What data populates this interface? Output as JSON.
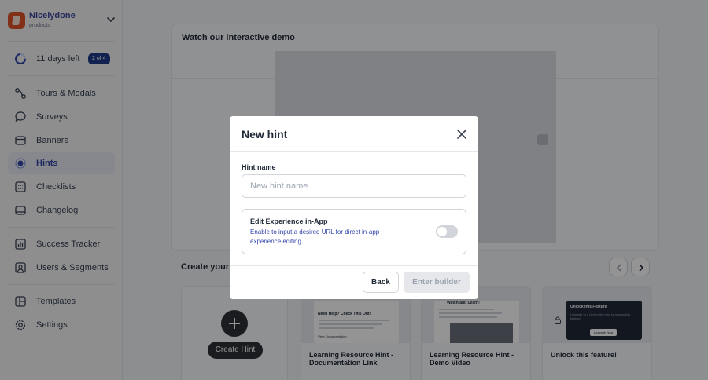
{
  "brand": {
    "name": "Nicelydone",
    "sub": "products"
  },
  "trial": {
    "text": "11 days left",
    "badge": "2 of 4"
  },
  "sidebar": {
    "items": [
      {
        "label": "Tours & Modals",
        "icon": "tours-icon"
      },
      {
        "label": "Surveys",
        "icon": "surveys-icon"
      },
      {
        "label": "Banners",
        "icon": "banners-icon"
      },
      {
        "label": "Hints",
        "icon": "hints-icon",
        "active": true
      },
      {
        "label": "Checklists",
        "icon": "checklists-icon"
      },
      {
        "label": "Changelog",
        "icon": "changelog-icon"
      },
      {
        "label": "Success Tracker",
        "icon": "success-tracker-icon"
      },
      {
        "label": "Users & Segments",
        "icon": "users-segments-icon"
      },
      {
        "label": "Templates",
        "icon": "templates-icon"
      },
      {
        "label": "Settings",
        "icon": "settings-icon"
      }
    ]
  },
  "main": {
    "demo_title": "Watch our interactive demo",
    "create_title": "Create your fi",
    "templates": [
      {
        "label": "Create Hint",
        "type": "create"
      },
      {
        "label": "Learning Resource Hint - Documentation Link",
        "preview_heading": "Need Help? Check This Out!",
        "preview_link": "View Documentation"
      },
      {
        "label": "Learning Resource Hint - Demo Video",
        "preview_heading": "Watch and Learn!"
      },
      {
        "label": "Unlock this feature!",
        "preview_heading": "Unlock this Feature",
        "preview_desc": "Upgrade to a higher-tier plan to access this feature!",
        "preview_button": "Upgrade Now"
      }
    ]
  },
  "modal": {
    "title": "New hint",
    "field_label": "Hint name",
    "field_placeholder": "New hint name",
    "field_value": "",
    "edit_title": "Edit Experience in-App",
    "edit_desc": "Enable to input a desired URL for direct in-app experience editing",
    "toggle_on": false,
    "back_label": "Back",
    "enter_label": "Enter builder"
  },
  "colors": {
    "accent": "#3346a8",
    "brand": "#e0542a",
    "dark": "#2f3137"
  }
}
